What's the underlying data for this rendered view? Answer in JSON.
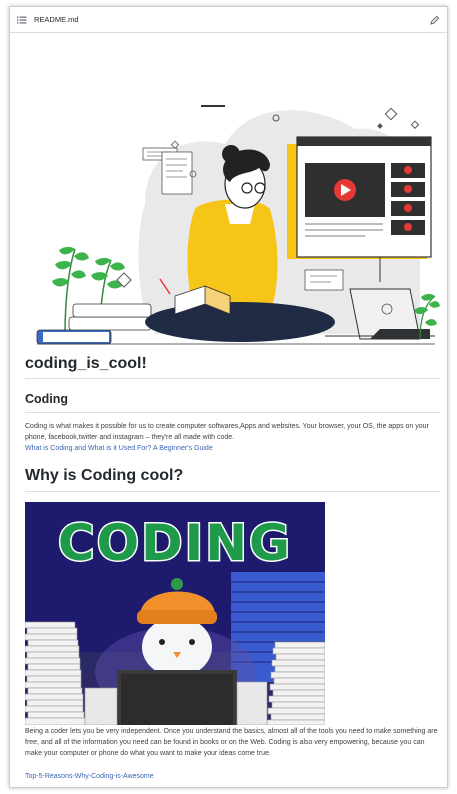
{
  "header": {
    "file_name": "README.md",
    "list_icon": "list-icon",
    "edit_icon": "pencil-icon"
  },
  "readme": {
    "title": "coding_is_cool!",
    "section_heading": "Coding",
    "intro_paragraph": "Coding is what makes it possible for us to create computer softwares,Apps and websites. Your browser, your OS, the apps on your phone, facebook,twitter and instagram – they're all made with code.",
    "intro_link": "What is Coding and What is it Used For? A Beginner's Guide",
    "why_heading": "Why is Coding cool?",
    "gif_text": "CODING",
    "why_paragraph": "Being a coder lets you be very independent. Once you understand the basics, almost all of the tools you need to make something are free, and all of the information you need can be found in books or on the Web. Coding is also very empowering, because you can make your computer or phone do what you want to make your ideas come true.",
    "why_link": "Top-5-Reasons-Why-Coding-is-Awesome"
  },
  "colors": {
    "link": "#3c64b4",
    "illustration_yellow": "#f5c518",
    "youtube_red": "#e53935",
    "plant_green": "#3cb44b",
    "gif_background": "#1e1a6e",
    "gif_text_green": "#1f9a4a",
    "hat_orange": "#f0902a"
  }
}
